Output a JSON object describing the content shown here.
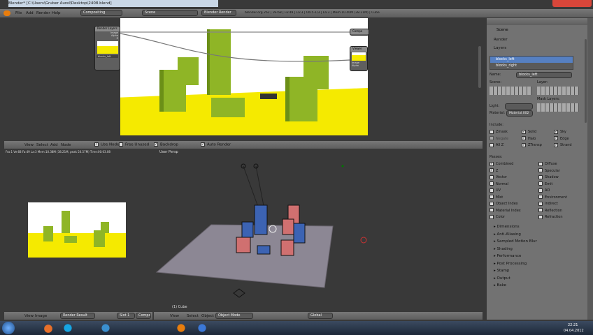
{
  "window": {
    "title": "Blender* [C:\\Users\\Gruber Aurel\\Desktop\\2408.blend]"
  },
  "topbar": {
    "menus": [
      "File",
      "Add",
      "Render",
      "Help"
    ],
    "screen": "Compositing",
    "scene": "Scene",
    "engine": "Blender Render",
    "info": "blender.org 262 | Ve:68 | Fa:49 | La:3 | Ob:5-1/3 | La:3 | Mem:10.40M (38.21M) | Cube"
  },
  "node_editor": {
    "render_layers_node": {
      "title": "Render Layers",
      "outputs": [
        "Image",
        "Alpha",
        "Z"
      ],
      "layer": "blocks_left"
    },
    "composite_node": {
      "title": "Compo"
    },
    "viewer_node": {
      "title": "Viewer",
      "inputs": [
        "Image",
        "Alpha"
      ]
    },
    "header": {
      "menus": [
        "View",
        "Select",
        "Add",
        "Node"
      ],
      "use_nodes": "Use Nodes",
      "free_unused": "Free Unused",
      "backdrop": "Backdrop",
      "auto_render": "Auto Render"
    }
  },
  "image_editor": {
    "info": "Fra:1 Ve:68 Fa:49 La:3 Mem:10.38M (38.21M, peak 50.57M) Time:00:03.08",
    "header": {
      "menus": [
        "View",
        "Image"
      ],
      "image": "Render Result",
      "slot": "Slot 1",
      "pass": "Compos"
    }
  },
  "viewport": {
    "label": "User Persp",
    "object": "(1) Cube",
    "header": {
      "menus": [
        "View",
        "Select",
        "Object"
      ],
      "mode": "Object Mode",
      "orientation": "Global"
    }
  },
  "properties": {
    "context": "Scene",
    "render_panel": "Render",
    "layers_panel": "Layers",
    "layers": [
      "blocks_left",
      "blocks_right"
    ],
    "name_label": "Name:",
    "name_value": "blocks_left",
    "scene_label": "Scene:",
    "layer_label": "Layer:",
    "mask_layers": "Mask Layers:",
    "light_label": "Light:",
    "material_label": "Material:",
    "material_value": "Material.002",
    "include_label": "Include:",
    "include_col1": [
      "Zmask",
      "Negate",
      "All Z"
    ],
    "include_col2": [
      "Solid",
      "Halo",
      "ZTransp"
    ],
    "include_col3": [
      "Sky",
      "Edge",
      "Strand"
    ],
    "passes_label": "Passes:",
    "passes_left": [
      "Combined",
      "Z",
      "Vector",
      "Normal",
      "UV",
      "Mist",
      "Object Index",
      "Material Index",
      "Color"
    ],
    "passes_right": [
      "Diffuse",
      "Specular",
      "Shadow",
      "Emit",
      "AO",
      "Environment",
      "Indirect",
      "Reflection",
      "Refraction"
    ],
    "panels": [
      "Dimensions",
      "Anti-Aliasing",
      "Sampled Motion Blur",
      "Shading",
      "Performance",
      "Post Processing",
      "Stamp",
      "Output",
      "Bake"
    ]
  },
  "taskbar": {
    "time": "22:21",
    "date": "04.04.2012"
  }
}
